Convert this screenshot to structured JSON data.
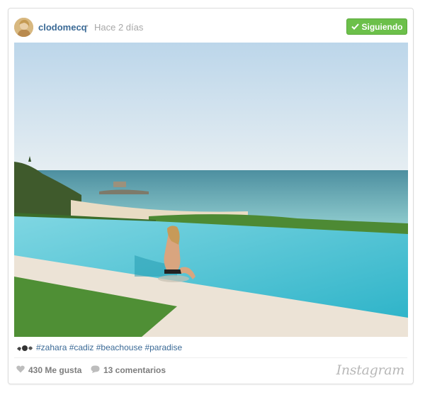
{
  "post": {
    "username": "clodomecq",
    "separator": "•",
    "time": "Hace 2 días",
    "follow_label": "Siguiendo"
  },
  "caption": {
    "text": "#zahara #cadiz #beachouse #paradise"
  },
  "stats": {
    "likes": "430 Me gusta",
    "comments": "13 comentarios"
  },
  "brand": {
    "logo_text": "Instagram"
  },
  "colors": {
    "link": "#3b6a96",
    "follow_button": "#6cc04a",
    "muted": "#a8a8a8"
  },
  "icons": [
    "check-icon",
    "heart-icon",
    "comment-icon",
    "emoji-icon"
  ]
}
